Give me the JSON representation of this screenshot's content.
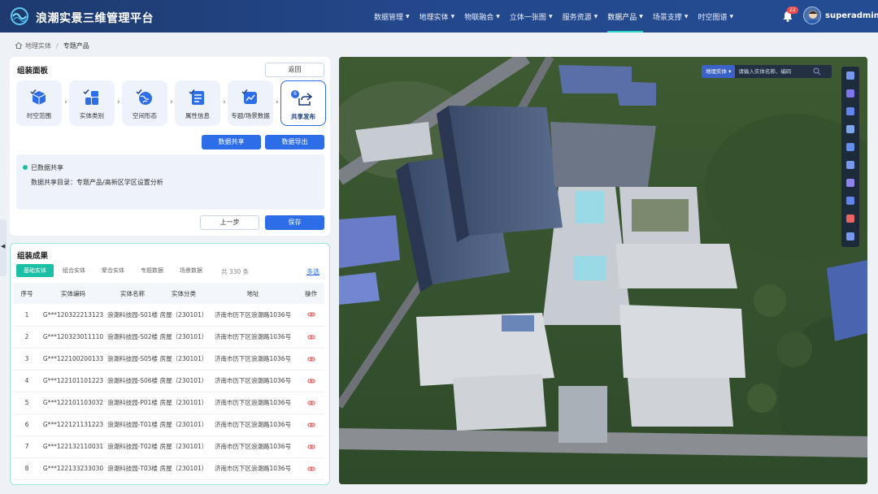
{
  "app": {
    "title": "浪潮实景三维管理平台"
  },
  "nav": [
    {
      "label": "数据管理",
      "active": false
    },
    {
      "label": "地理实体",
      "active": false
    },
    {
      "label": "物联融合",
      "active": false
    },
    {
      "label": "立体一张图",
      "active": false
    },
    {
      "label": "服务资源",
      "active": false
    },
    {
      "label": "数据产品",
      "active": true
    },
    {
      "label": "场景支撑",
      "active": false
    },
    {
      "label": "时空图谱",
      "active": false
    }
  ],
  "header": {
    "notification_count": "22",
    "username": "superadmin"
  },
  "breadcrumb": {
    "parent": "地理实体",
    "current": "专题产品"
  },
  "assembly": {
    "title": "组装面板",
    "back_label": "返回",
    "steps": [
      {
        "label": "时空范围",
        "icon": "cube-check-icon"
      },
      {
        "label": "实体类别",
        "icon": "grid-check-icon"
      },
      {
        "label": "空间形态",
        "icon": "globe-check-icon"
      },
      {
        "label": "属性信息",
        "icon": "list-check-icon"
      },
      {
        "label": "专题/场景数据",
        "icon": "chart-check-icon"
      },
      {
        "label": "共享发布",
        "icon": "share-icon",
        "number": "6"
      }
    ],
    "data_share_label": "数据共享",
    "data_export_label": "数据导出",
    "share_status": "已数据共享",
    "share_directory": "数据共享目录：专题产品/高新区学区设置分析",
    "prev_label": "上一步",
    "save_label": "保存"
  },
  "results": {
    "title": "组装成果",
    "tabs": [
      {
        "label": "基础实体",
        "active": true
      },
      {
        "label": "组合实体",
        "active": false
      },
      {
        "label": "聚合实体",
        "active": false
      },
      {
        "label": "专题数据",
        "active": false
      },
      {
        "label": "场景数据",
        "active": false
      }
    ],
    "total": "共 330 条",
    "multi_select": "多选",
    "columns": [
      "序号",
      "实体编码",
      "实体名称",
      "实体分类",
      "地址",
      "操作"
    ],
    "rows": [
      {
        "no": "1",
        "code": "G***120322213123",
        "name": "浪潮科技园-S01楼",
        "category": "房屋（230101）",
        "address": "济南市历下区浪潮路1036号"
      },
      {
        "no": "2",
        "code": "G***120323011110",
        "name": "浪潮科技园-S02楼",
        "category": "房屋（230101）",
        "address": "济南市历下区浪潮路1036号"
      },
      {
        "no": "3",
        "code": "G***122100200133",
        "name": "浪潮科技园-S05楼",
        "category": "房屋（230101）",
        "address": "济南市历下区浪潮路1036号"
      },
      {
        "no": "4",
        "code": "G***122101101223",
        "name": "浪潮科技园-S06楼",
        "category": "房屋（230101）",
        "address": "济南市历下区浪潮路1036号"
      },
      {
        "no": "5",
        "code": "G***122101103032",
        "name": "浪潮科技园-P01楼",
        "category": "房屋（230101）",
        "address": "济南市历下区浪潮路1036号"
      },
      {
        "no": "6",
        "code": "G***122121131223",
        "name": "浪潮科技园-T01楼",
        "category": "房屋（230101）",
        "address": "济南市历下区浪潮路1036号"
      },
      {
        "no": "7",
        "code": "G***122132110031",
        "name": "浪潮科技园-T02楼",
        "category": "房屋（230101）",
        "address": "济南市历下区浪潮路1036号"
      },
      {
        "no": "8",
        "code": "G***122133233030",
        "name": "浪潮科技园-T03楼",
        "category": "房屋（230101）",
        "address": "济南市历下区浪潮路1036号"
      }
    ]
  },
  "map": {
    "search_type": "地理实体",
    "search_placeholder": "请输入实体名称、编码",
    "tools": [
      "fullscreen-icon",
      "layer-icon",
      "split-view-icon",
      "measure-icon",
      "sound-icon",
      "ruler-icon",
      "node-icon",
      "download-icon",
      "trash-icon",
      "print-icon"
    ]
  },
  "colors": {
    "accent": "#2d6ee8",
    "teal": "#1bbfa5",
    "header": "#23478a"
  }
}
